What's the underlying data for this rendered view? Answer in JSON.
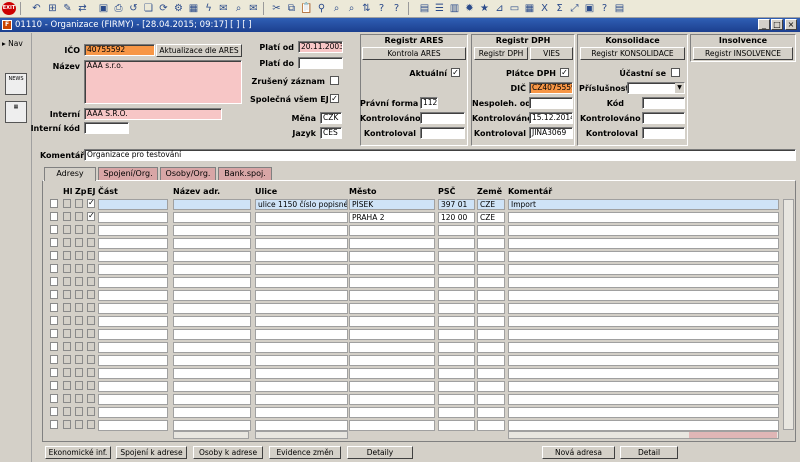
{
  "window": {
    "title": "01110 - Organizace (FIRMY) - [28.04.2015; 09:17] [ ] [ ]",
    "exit_label": "EXIT"
  },
  "sidebar": {
    "nav_label": "Nav",
    "news_label": "NEWS"
  },
  "header": {
    "ico_label": "IČO",
    "ico_value": "40755592",
    "update_ares_label": "Aktualizace dle ARES",
    "nazev_label": "Název",
    "nazev_value": "AAA s.r.o.",
    "interni_label": "Interní",
    "interni_value": "AAA S.R.O.",
    "interni_kod_label": "Interní kód",
    "interni_kod_value": "",
    "plati_od_label": "Platí od",
    "plati_od_value": "20.11.2003",
    "plati_do_label": "Platí do",
    "plati_do_value": "",
    "zruseny_label": "Zrušený záznam",
    "spolecna_label": "Společná všem EJ",
    "mena_label": "Měna",
    "mena_value": "CZK",
    "jazyk_label": "Jazyk",
    "jazyk_value": "ČES",
    "komentar_label": "Komentář",
    "komentar_value": "Organizace pro testování"
  },
  "ares": {
    "title": "Registr ARES",
    "button": "Kontrola ARES",
    "aktualni_label": "Aktuální",
    "pravni_forma_label": "Právní forma",
    "pravni_forma_value": "112",
    "kontrolovano_label": "Kontrolováno",
    "kontrolovano_value": "",
    "kontroloval_label": "Kontroloval",
    "kontroloval_value": ""
  },
  "dph": {
    "title": "Registr DPH",
    "button": "Registr DPH",
    "vies_button": "VIES",
    "platce_label": "Plátce DPH",
    "dic_label": "DIČ",
    "dic_value": "CZ40755592",
    "nespoleh_label": "Nespoleh. od",
    "nespoleh_value": "",
    "kontrolovano_label": "Kontrolováno",
    "kontrolovano_value": "15.12.2014",
    "kontroloval_label": "Kontroloval",
    "kontroloval_value": "JINA3069"
  },
  "konsolidace": {
    "title": "Konsolidace",
    "button": "Registr KONSOLIDACE",
    "ucastni_label": "Účastní se",
    "prislusnost_label": "Příslušnost",
    "prislusnost_value": "",
    "kod_label": "Kód",
    "kod_value": "",
    "kontrolovano_label": "Kontrolováno",
    "kontrolovano_value": "",
    "kontroloval_label": "Kontroloval",
    "kontroloval_value": ""
  },
  "insolvence": {
    "title": "Insolvence",
    "button": "Registr INSOLVENCE"
  },
  "tabs": [
    "Adresy",
    "Spojení/Org.",
    "Osoby/Org.",
    "Bank.spoj."
  ],
  "table": {
    "columns": [
      "Hl",
      "Zp",
      "EJ",
      "Část",
      "Název adr.",
      "Ulice",
      "Město",
      "PSČ",
      "Země",
      "Komentář"
    ],
    "rows": [
      {
        "cast": "",
        "nazev": "",
        "ulice": "ulice 1150 číslo popisné 11",
        "mesto": "PÍSEK",
        "psc": "397 01",
        "zeme": "CZE",
        "komentar": "Import"
      },
      {
        "cast": "",
        "nazev": "",
        "ulice": "",
        "mesto": "PRAHA 2",
        "psc": "120 00",
        "zeme": "CZE",
        "komentar": ""
      }
    ]
  },
  "buttons": {
    "ekonomicke": "Ekonomické inf.",
    "spojeni": "Spojení k adrese",
    "osoby": "Osoby k adrese",
    "evidence": "Evidence změn",
    "detaily": "Detaily",
    "nova_adresa": "Nová adresa",
    "detail": "Detail"
  },
  "colors": {
    "pink": "#f7c6c6",
    "orange": "#f79646",
    "selected_row": "#cfe3f7",
    "title_bar": "#1c3f8e"
  }
}
